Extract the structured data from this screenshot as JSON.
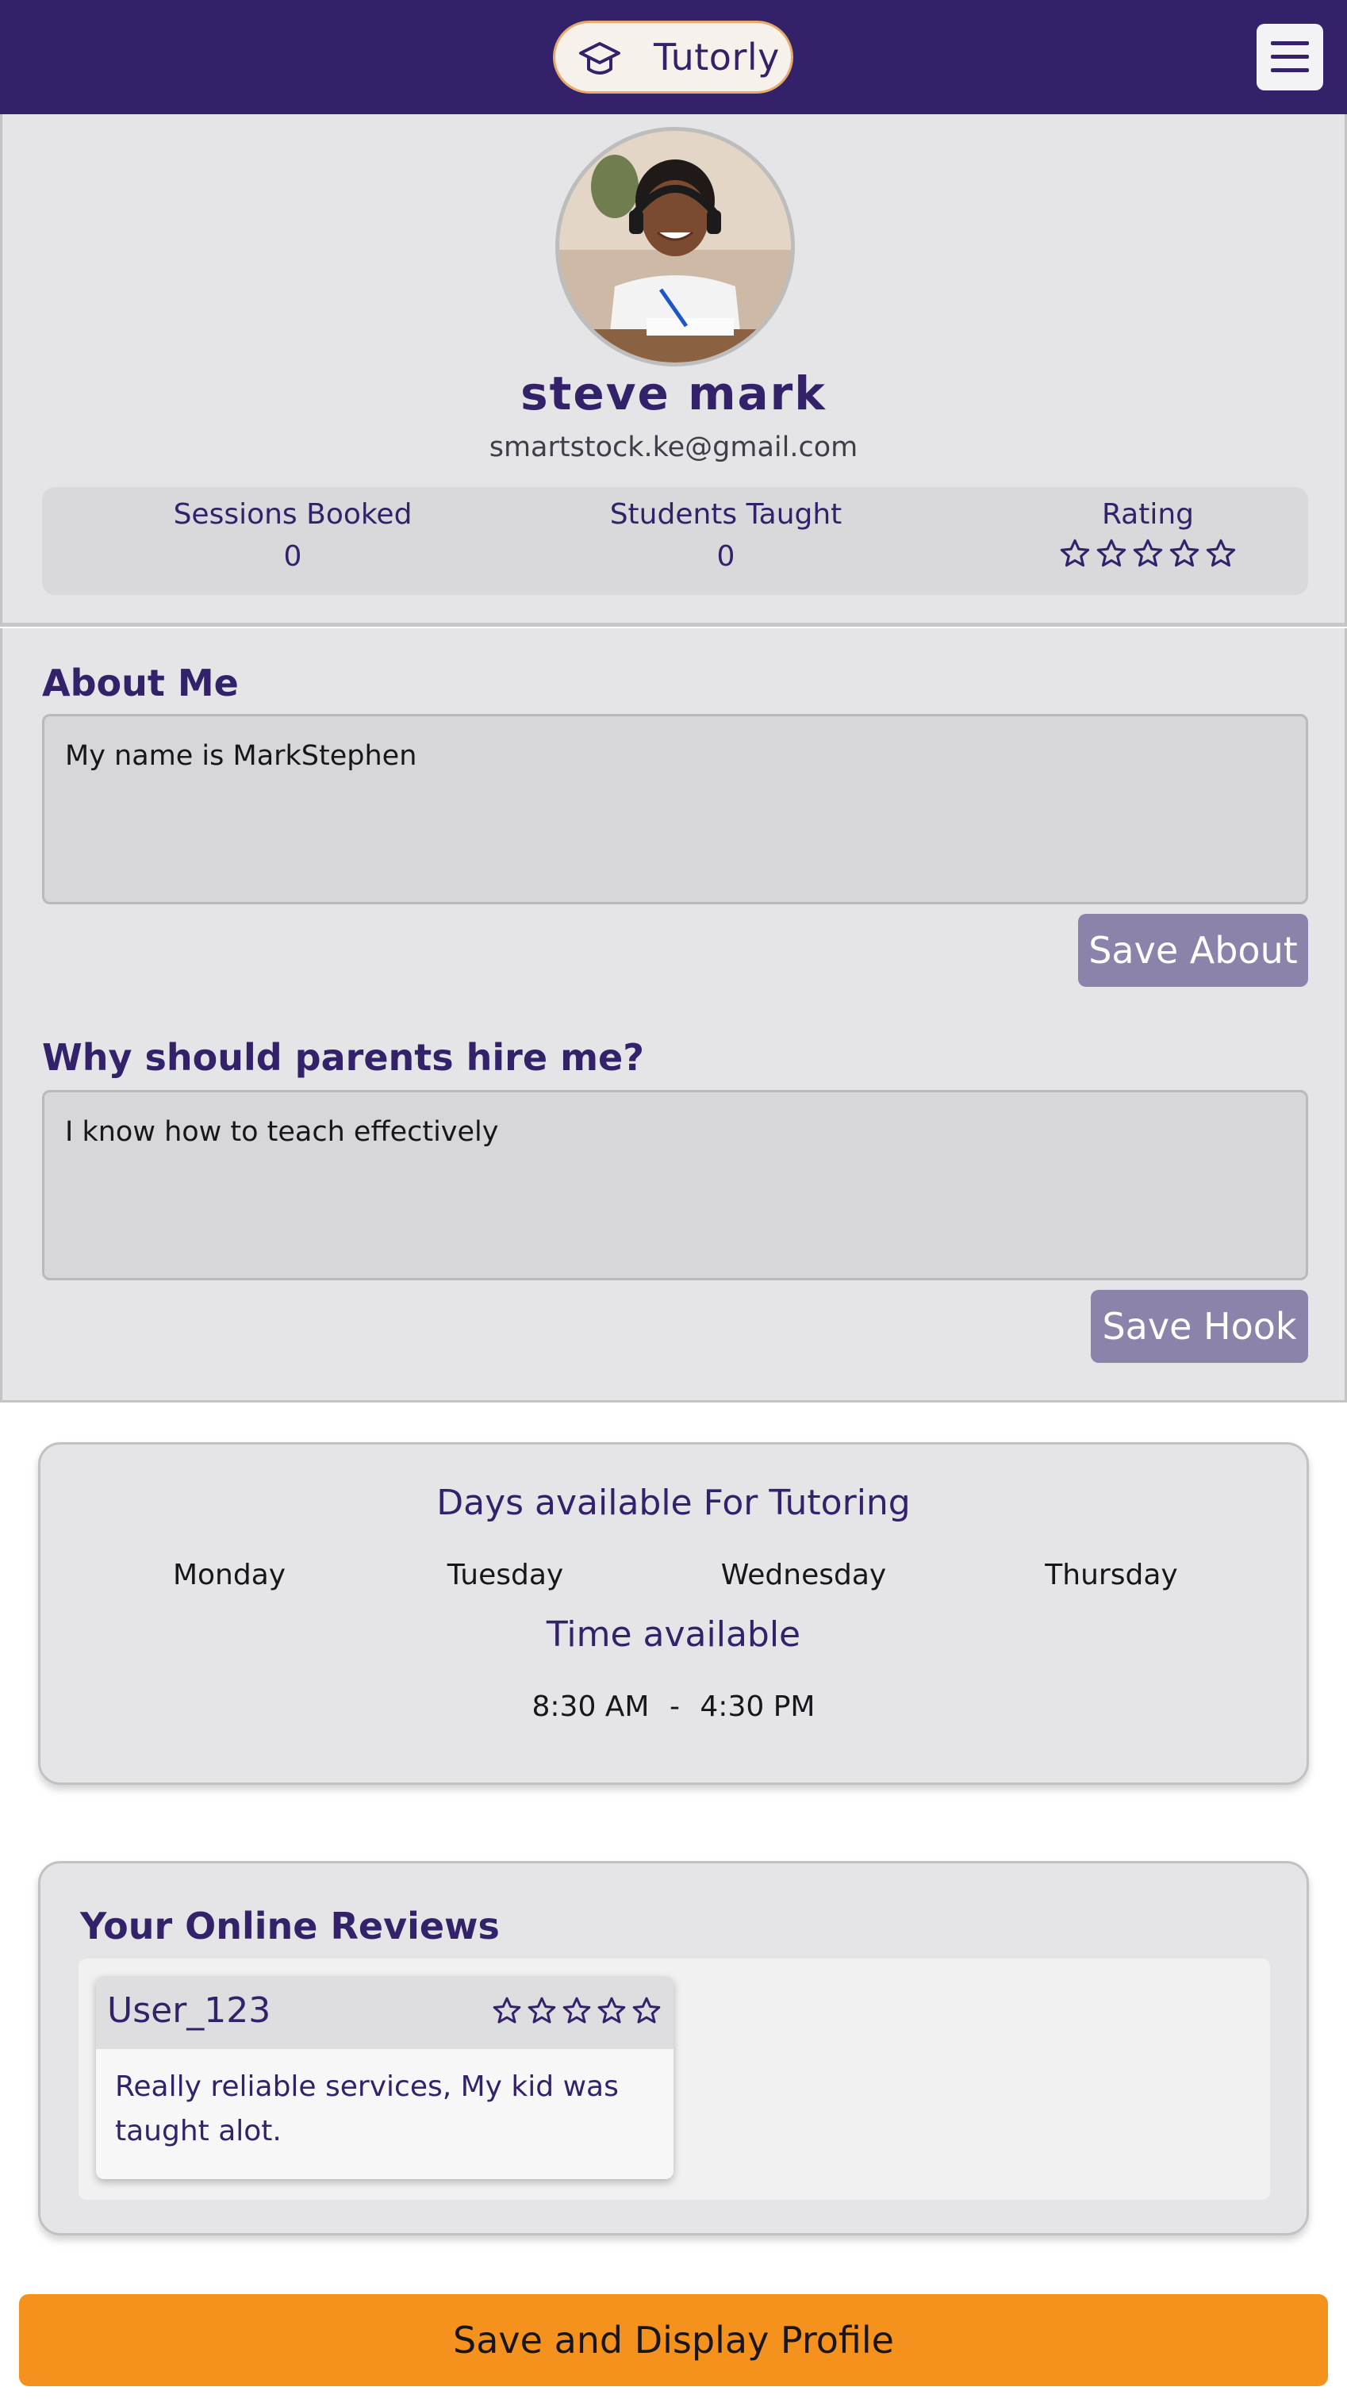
{
  "header": {
    "brand_name": "Tutorly",
    "brand_icon": "graduation-cap-icon",
    "menu_icon": "hamburger-menu-icon",
    "background_color": "#33226a"
  },
  "profile": {
    "name": "steve mark",
    "email": "smartstock.ke@gmail.com",
    "avatar": "profile-photo",
    "stats": {
      "sessions_label": "Sessions Booked",
      "sessions_value": "0",
      "students_label": "Students Taught",
      "students_value": "0",
      "rating_label": "Rating",
      "rating_value": 0,
      "rating_max": 5
    }
  },
  "about": {
    "title": "About Me",
    "text": "My name is MarkStephen",
    "save_label": "Save About"
  },
  "hook": {
    "title": "Why should parents hire me?",
    "text": "I know how to teach effectively",
    "save_label": "Save Hook"
  },
  "availability": {
    "days_title": "Days available For Tutoring",
    "days": [
      "Monday",
      "Tuesday",
      "Wednesday",
      "Thursday"
    ],
    "time_title": "Time available",
    "start_time": "8:30 AM",
    "separator": "-",
    "end_time": "4:30 PM"
  },
  "reviews": {
    "title": "Your Online Reviews",
    "items": [
      {
        "user": "User_123",
        "rating": 0,
        "text": "Really reliable services, My kid was taught alot."
      }
    ]
  },
  "actions": {
    "save_display_label": "Save and Display Profile",
    "accent_color": "#f5921e"
  }
}
